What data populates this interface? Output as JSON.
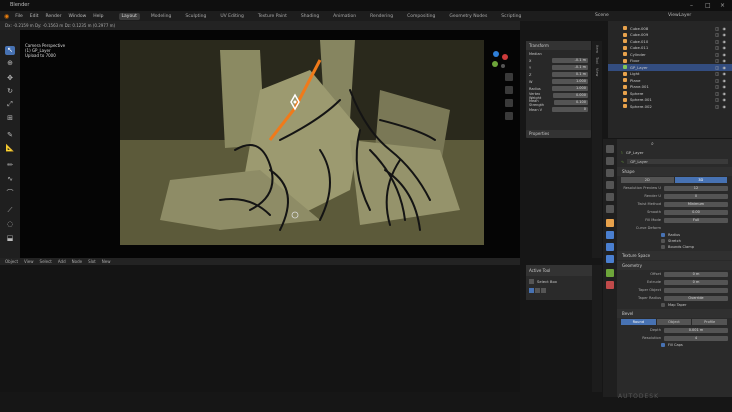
{
  "window": {
    "title": "Blender"
  },
  "menu": {
    "items": [
      "File",
      "Edit",
      "Render",
      "Window",
      "Help"
    ],
    "workspaces": [
      "Layout",
      "Modeling",
      "Sculpting",
      "UV Editing",
      "Texture Paint",
      "Shading",
      "Animation",
      "Rendering",
      "Compositing",
      "Geometry Nodes",
      "Scripting"
    ],
    "active_workspace": "Layout",
    "scene_label": "Scene",
    "view_layer_label": "ViewLayer"
  },
  "viewport": {
    "header_text": "Dx: -0.2159 m  Dy: -0.1563 m  Dz: 0.1235 m  (0.2977 m)",
    "overlay": [
      "Camera Perspective",
      "(1) GP_Layer",
      "Upload to 7000"
    ],
    "npanel_title": "Transform",
    "npanel_rows": [
      {
        "label": "Median",
        "value": ""
      },
      {
        "label": "X",
        "value": "-0.1 m"
      },
      {
        "label": "Y",
        "value": "-0.1 m"
      },
      {
        "label": "Z",
        "value": "0.1 m"
      },
      {
        "label": "W",
        "value": "1.000"
      },
      {
        "label": "Radius",
        "value": "1.000"
      },
      {
        "label": "Vertex Weight",
        "value": "0.000"
      },
      {
        "label": "Mean Strength",
        "value": "0.100"
      },
      {
        "label": "Mean V",
        "value": "0"
      }
    ],
    "npanel2_title": "Properties"
  },
  "bottom_editor": {
    "header": [
      "Object",
      "View",
      "Select",
      "Add",
      "Node",
      "Slot",
      "New"
    ],
    "active_tool_title": "Active Tool",
    "active_tool_name": "Select Box"
  },
  "outliner": {
    "items": [
      {
        "name": "Cube.008",
        "color": "#e8a24c"
      },
      {
        "name": "Cube.009",
        "color": "#e8a24c"
      },
      {
        "name": "Cube.010",
        "color": "#e8a24c"
      },
      {
        "name": "Cube.011",
        "color": "#e8a24c"
      },
      {
        "name": "Cylinder",
        "color": "#e8a24c"
      },
      {
        "name": "Floor",
        "color": "#e8a24c"
      },
      {
        "name": "GP_Layer",
        "color": "#7fc65a",
        "selected": true
      },
      {
        "name": "Light",
        "color": "#e8a24c"
      },
      {
        "name": "Plane",
        "color": "#e8a24c"
      },
      {
        "name": "Plane.001",
        "color": "#e8a24c"
      },
      {
        "name": "Sphere",
        "color": "#e8a24c"
      },
      {
        "name": "Sphere.001",
        "color": "#e8a24c"
      },
      {
        "name": "Sphere.002",
        "color": "#e8a24c"
      }
    ]
  },
  "properties": {
    "object_name": "GP_Layer",
    "data_name": "GP_Layer",
    "shape_section": "Shape",
    "dims": [
      "2D",
      "3D"
    ],
    "active_dim": "3D",
    "rows": [
      {
        "label": "Resolution Preview U",
        "value": "12"
      },
      {
        "label": "Render U",
        "value": "0"
      },
      {
        "label": "Twist Method",
        "value": "Minimum"
      },
      {
        "label": "Smooth",
        "value": "0.00"
      },
      {
        "label": "Fill Mode",
        "value": "Full"
      }
    ],
    "curve_deform": "Curve Deform",
    "checkboxes": [
      {
        "label": "Radius",
        "on": true
      },
      {
        "label": "Stretch",
        "on": false
      },
      {
        "label": "Bounds Clamp",
        "on": false
      }
    ],
    "texture_space": "Texture Space",
    "geometry": "Geometry",
    "geo_rows": [
      {
        "label": "Offset",
        "value": "0 m"
      },
      {
        "label": "Extrude",
        "value": "0 m"
      },
      {
        "label": "Taper Object",
        "value": ""
      },
      {
        "label": "Taper Radius",
        "value": "Override"
      }
    ],
    "map_taper": "Map Taper",
    "bevel": "Bevel",
    "bevel_modes": [
      "Round",
      "Object",
      "Profile"
    ],
    "active_bevel": "Round",
    "bevel_rows": [
      {
        "label": "Depth",
        "value": "0.001 m"
      },
      {
        "label": "Resolution",
        "value": "4"
      }
    ],
    "fill_caps": "Fill Caps"
  },
  "watermark": "AUTODESK"
}
